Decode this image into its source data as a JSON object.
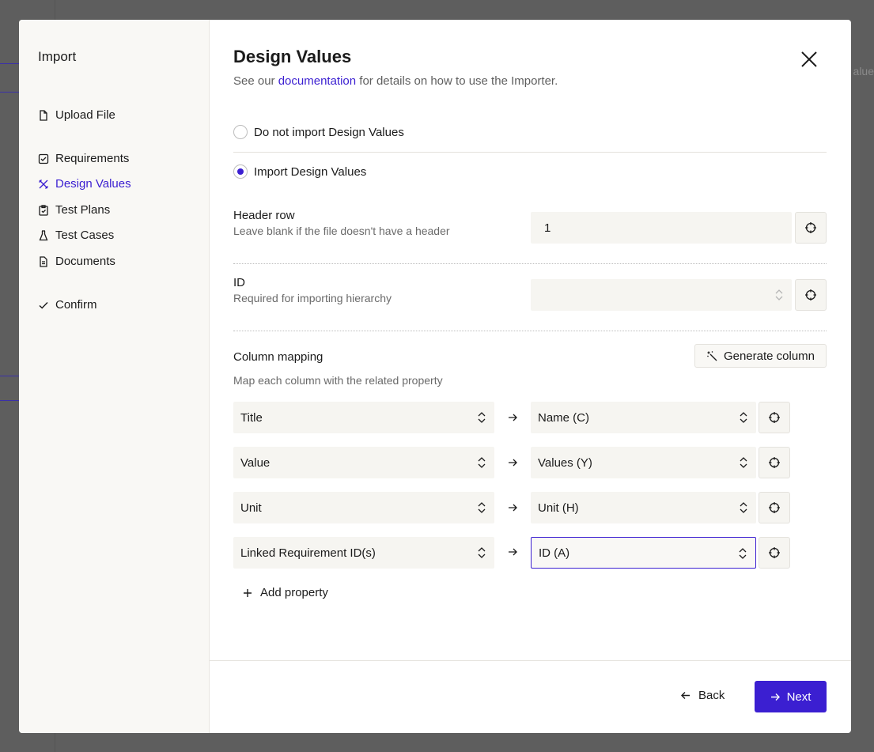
{
  "background": {
    "partial_text": "alue"
  },
  "sidebar": {
    "title": "Import",
    "items": [
      {
        "label": "Upload File",
        "icon": "file-icon",
        "active": false
      },
      {
        "label": "Requirements",
        "icon": "checkbox-icon",
        "active": false
      },
      {
        "label": "Design Values",
        "icon": "design-icon",
        "active": true
      },
      {
        "label": "Test Plans",
        "icon": "clipboard-icon",
        "active": false
      },
      {
        "label": "Test Cases",
        "icon": "flask-icon",
        "active": false
      },
      {
        "label": "Documents",
        "icon": "document-icon",
        "active": false
      },
      {
        "label": "Confirm",
        "icon": "check-icon",
        "active": false
      }
    ]
  },
  "main": {
    "title": "Design Values",
    "subtitle_before": "See our ",
    "subtitle_link": "documentation",
    "subtitle_after": " for details on how to use the Importer.",
    "options": {
      "no_import": "Do not import Design Values",
      "import": "Import Design Values",
      "selected": "import"
    },
    "header_row": {
      "label": "Header row",
      "help": "Leave blank if the file doesn't have a header",
      "value": "1"
    },
    "id_field": {
      "label": "ID",
      "help": "Required for importing hierarchy",
      "value": ""
    },
    "column_mapping": {
      "label": "Column mapping",
      "help": "Map each column with the related property",
      "generate_label": "Generate column",
      "rows": [
        {
          "property": "Title",
          "column": "Name (C)"
        },
        {
          "property": "Value",
          "column": "Values (Y)"
        },
        {
          "property": "Unit",
          "column": "Unit (H)"
        },
        {
          "property": "Linked Requirement ID(s)",
          "column": "ID (A)"
        }
      ],
      "add_property": "Add property"
    }
  },
  "footer": {
    "back": "Back",
    "next": "Next"
  },
  "colors": {
    "accent": "#3b1fd1",
    "sidebar_bg": "#f9f8f5",
    "field_bg": "#f6f5f1"
  }
}
